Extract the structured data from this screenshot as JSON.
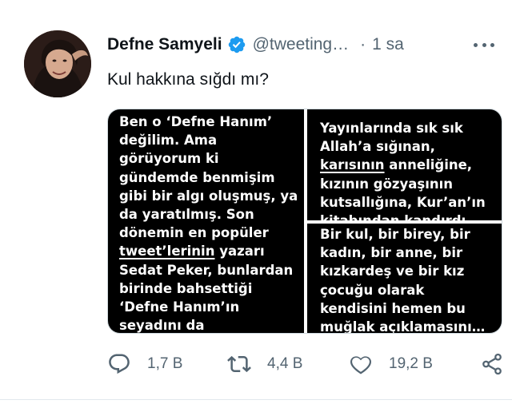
{
  "author": {
    "name": "Defne Samyeli",
    "handle": "@tweeting…",
    "separator": "·",
    "time": "1 sa"
  },
  "tweet": {
    "text": "Kul hakkına sığdı mı?"
  },
  "media": {
    "left_lines": [
      "Ben o ‘Defne Hanım’",
      "değilim. Ama",
      "görüyorum ki",
      "gündemde benmişim",
      "gibi bir algı oluşmuş, ya",
      "da yaratılmış. Son",
      "dönemin en popüler"
    ],
    "left_underlined_line": [
      "tweet’lerinin",
      " yazarı"
    ],
    "left_lines_2": [
      "Sedat Peker, bunlardan",
      "birinde bahsettiği",
      "‘Defne Hanım’ın",
      "seyadını da"
    ],
    "right_top_lines": [
      "Yayınlarında sık sık",
      "Allah’a sığınan,"
    ],
    "right_top_underlined": [
      "karısının",
      " anneliğine,"
    ],
    "right_top_lines_2": [
      "kızının gözyaşının",
      "kutsallığına, Kur’an’ın",
      "kitabından kandırdı…"
    ],
    "right_bottom_lines": [
      "Bir kul, bir birey, bir",
      "kadın, bir anne, bir",
      "kızkardeş ve bir kız",
      "çocuğu olarak",
      "kendisini hemen bu",
      "muğlak açıklamasını…"
    ]
  },
  "actions": {
    "reply_count": "1,7 B",
    "retweet_count": "4,4 B",
    "like_count": "19,2 B"
  },
  "icons": {
    "verified": "verified-badge-icon",
    "more": "more-dots-icon",
    "reply": "reply-icon",
    "retweet": "retweet-icon",
    "like": "heart-icon",
    "share": "share-icon"
  },
  "colors": {
    "verified_blue": "#1d9bf0",
    "secondary_text": "#536471",
    "primary_text": "#0f1419"
  }
}
